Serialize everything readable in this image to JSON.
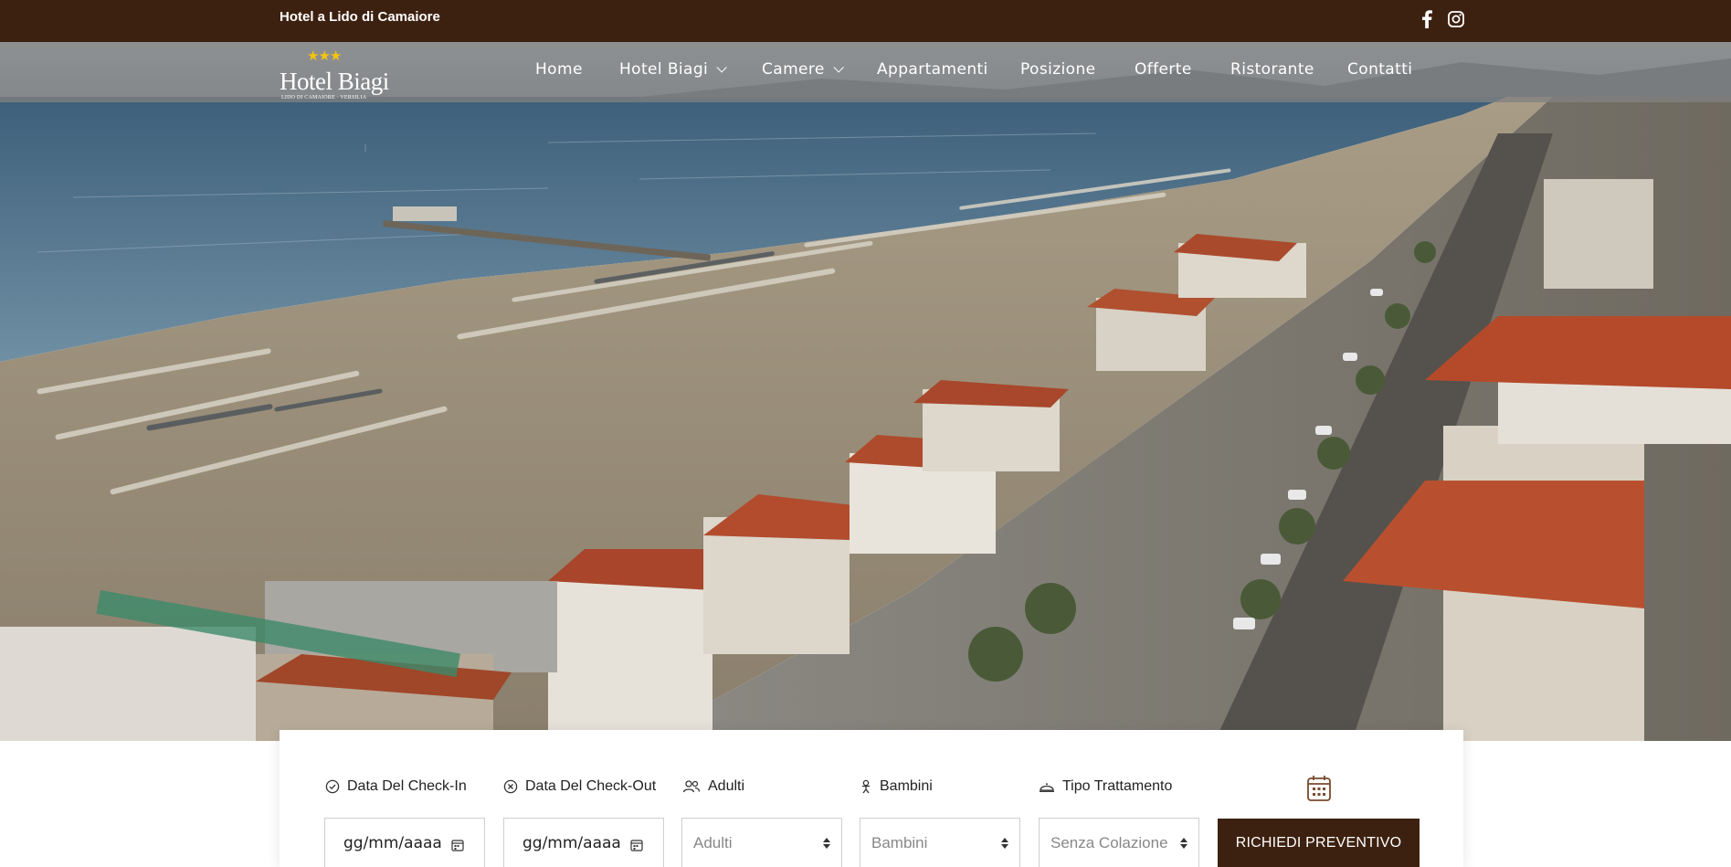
{
  "topbar": {
    "tagline": "Hotel a Lido di Camaiore",
    "social": [
      "facebook-icon",
      "instagram-icon"
    ]
  },
  "logo": {
    "stars": "★★★",
    "name": "Hotel Biagi",
    "subtitle": "LIDO DI CAMAIORE · VERSILIA"
  },
  "nav": {
    "items": [
      {
        "label": "Home",
        "dropdown": false
      },
      {
        "label": "Hotel Biagi",
        "dropdown": true
      },
      {
        "label": "Camere",
        "dropdown": true
      },
      {
        "label": "Appartamenti",
        "dropdown": false
      },
      {
        "label": "Posizione",
        "dropdown": false
      },
      {
        "label": "Offerte",
        "dropdown": false
      },
      {
        "label": "Ristorante",
        "dropdown": false
      },
      {
        "label": "Contatti",
        "dropdown": false
      }
    ]
  },
  "booking": {
    "checkin_label": "Data Del Check-In",
    "checkout_label": "Data Del Check-Out",
    "adults_label": "Adulti",
    "children_label": "Bambini",
    "treatment_label": "Tipo Trattamento",
    "checkin_value": "gg/mm/aaaa",
    "checkout_value": "gg/mm/aaaa",
    "adults_value": "Adulti",
    "children_value": "Bambini",
    "treatment_value": "Senza Colazione",
    "submit_label": "RICHIEDI PREVENTIVO"
  },
  "colors": {
    "brand_brown": "#3d2110",
    "star_gold": "#f4c30d",
    "nav_overlay": "#828282"
  }
}
